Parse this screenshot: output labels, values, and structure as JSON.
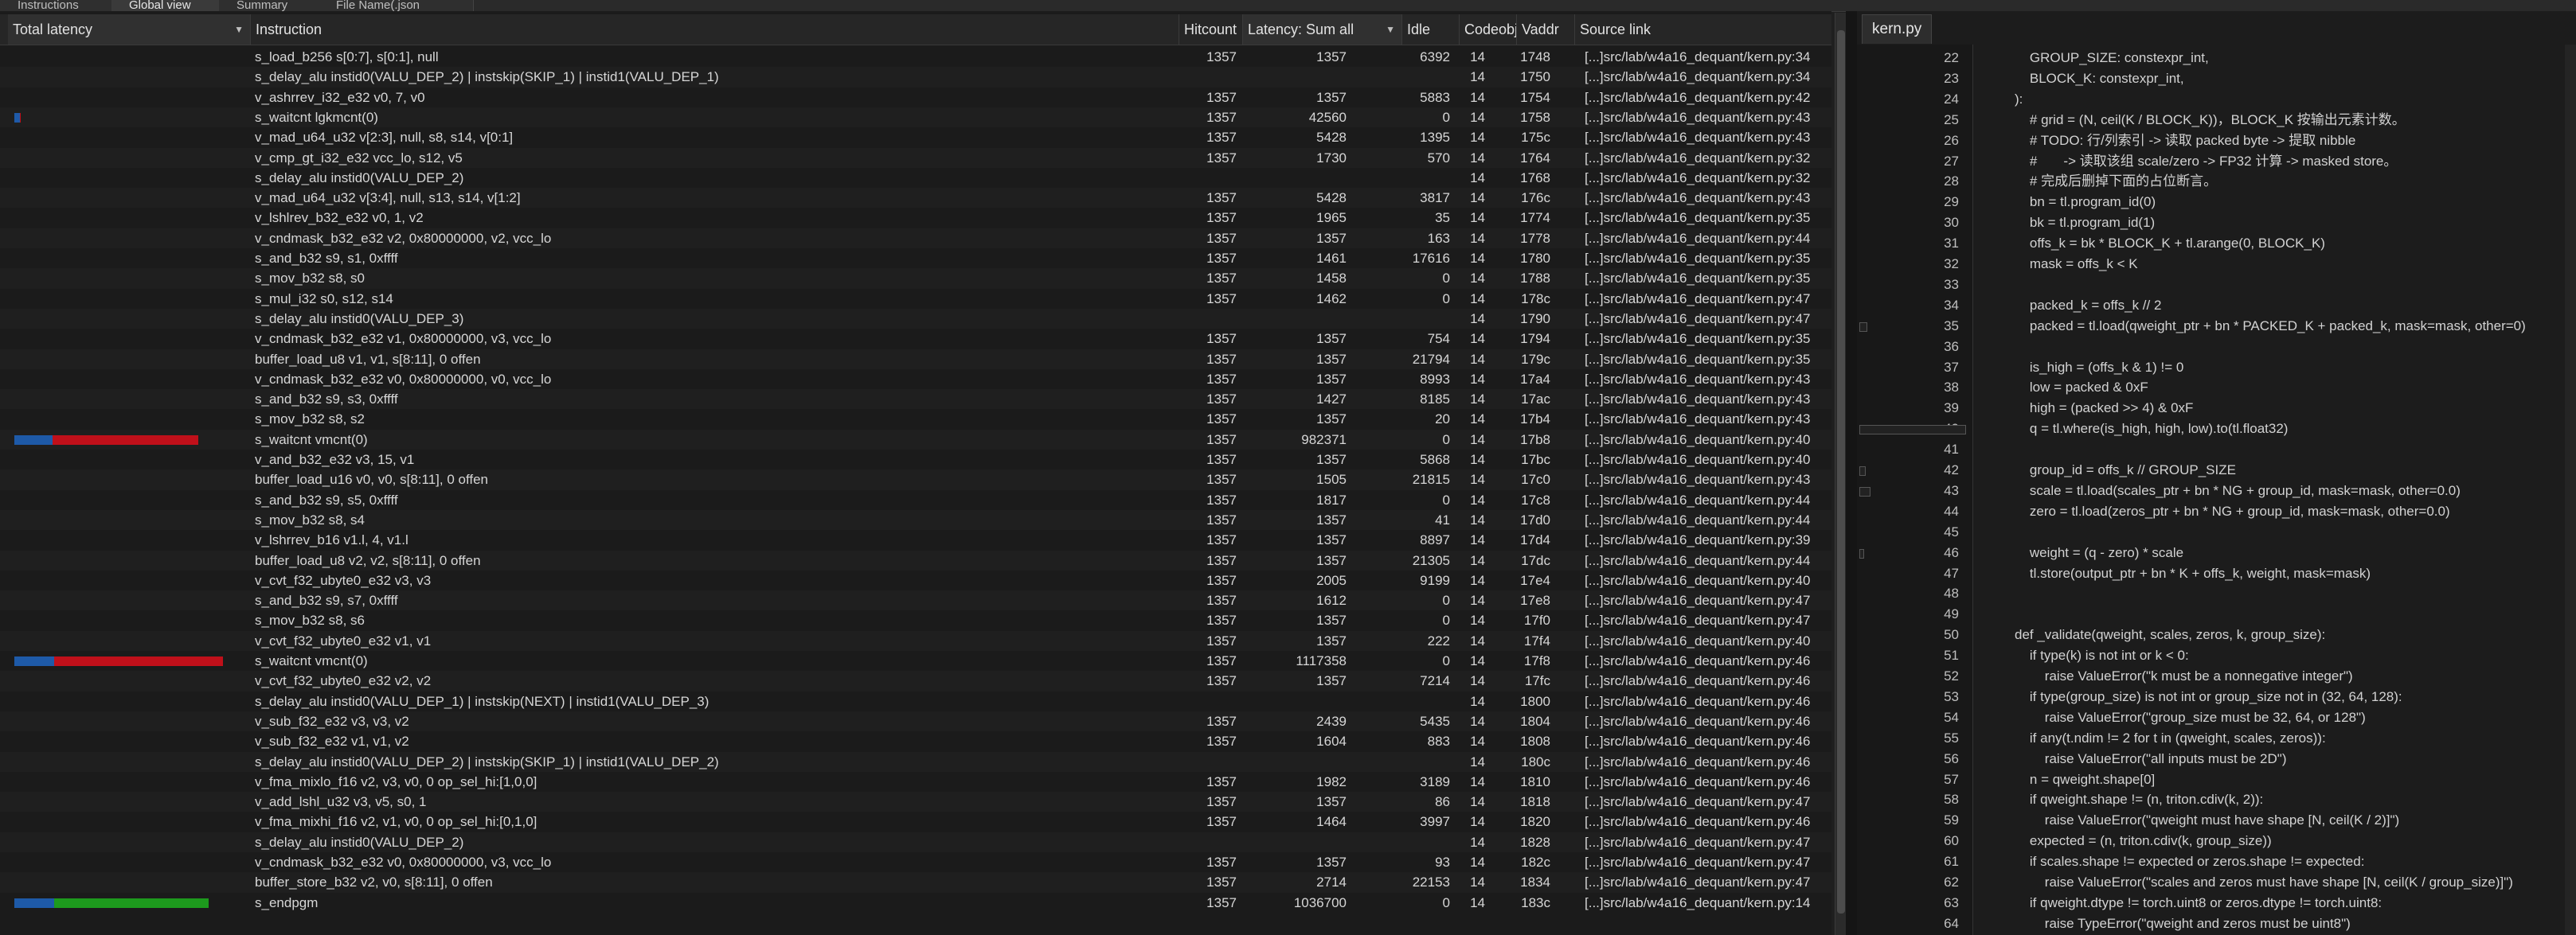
{
  "top_tabs": [
    "Instructions",
    "Global view",
    "Summary",
    "File Name(.json"
  ],
  "columns": {
    "total_latency": "Total latency",
    "instruction": "Instruction",
    "hitcount": "Hitcount",
    "latency": "Latency: Sum all",
    "idle": "Idle",
    "codeobj": "Codeobj",
    "vaddr": "Vaddr",
    "source": "Source link"
  },
  "rows": [
    {
      "instr": "s_load_b256 s[0:7], s[0:1], null",
      "hit": "1357",
      "lat": "1357",
      "idle": "6392",
      "co": "14",
      "va": "1748",
      "src": "[...]src/lab/w4a16_dequant/kern.py:34",
      "bar": 0
    },
    {
      "instr": "s_delay_alu instid0(VALU_DEP_2) | instskip(SKIP_1) | instid1(VALU_DEP_1)",
      "hit": "",
      "lat": "",
      "idle": "",
      "co": "14",
      "va": "1750",
      "src": "[...]src/lab/w4a16_dequant/kern.py:34",
      "bar": 0
    },
    {
      "instr": "v_ashrrev_i32_e32 v0, 7, v0",
      "hit": "1357",
      "lat": "1357",
      "idle": "5883",
      "co": "14",
      "va": "1754",
      "src": "[...]src/lab/w4a16_dequant/kern.py:42",
      "bar": 0
    },
    {
      "instr": "s_waitcnt lgkmcnt(0)",
      "hit": "1357",
      "lat": "42560",
      "idle": "0",
      "co": "14",
      "va": "1758",
      "src": "[...]src/lab/w4a16_dequant/kern.py:43",
      "bar": 0.03
    },
    {
      "instr": "v_mad_u64_u32 v[2:3], null, s8, s14, v[0:1]",
      "hit": "1357",
      "lat": "5428",
      "idle": "1395",
      "co": "14",
      "va": "175c",
      "src": "[...]src/lab/w4a16_dequant/kern.py:43",
      "bar": 0
    },
    {
      "instr": "v_cmp_gt_i32_e32 vcc_lo, s12, v5",
      "hit": "1357",
      "lat": "1730",
      "idle": "570",
      "co": "14",
      "va": "1764",
      "src": "[...]src/lab/w4a16_dequant/kern.py:32",
      "bar": 0
    },
    {
      "instr": "s_delay_alu instid0(VALU_DEP_2)",
      "hit": "",
      "lat": "",
      "idle": "",
      "co": "14",
      "va": "1768",
      "src": "[...]src/lab/w4a16_dequant/kern.py:32",
      "bar": 0
    },
    {
      "instr": "v_mad_u64_u32 v[3:4], null, s13, s14, v[1:2]",
      "hit": "1357",
      "lat": "5428",
      "idle": "3817",
      "co": "14",
      "va": "176c",
      "src": "[...]src/lab/w4a16_dequant/kern.py:43",
      "bar": 0
    },
    {
      "instr": "v_lshlrev_b32_e32 v0, 1, v2",
      "hit": "1357",
      "lat": "1965",
      "idle": "35",
      "co": "14",
      "va": "1774",
      "src": "[...]src/lab/w4a16_dequant/kern.py:35",
      "bar": 0
    },
    {
      "instr": "v_cndmask_b32_e32 v2, 0x80000000, v2, vcc_lo",
      "hit": "1357",
      "lat": "1357",
      "idle": "163",
      "co": "14",
      "va": "1778",
      "src": "[...]src/lab/w4a16_dequant/kern.py:44",
      "bar": 0
    },
    {
      "instr": "s_and_b32 s9, s1, 0xffff",
      "hit": "1357",
      "lat": "1461",
      "idle": "17616",
      "co": "14",
      "va": "1780",
      "src": "[...]src/lab/w4a16_dequant/kern.py:35",
      "bar": 0
    },
    {
      "instr": "s_mov_b32 s8, s0",
      "hit": "1357",
      "lat": "1458",
      "idle": "0",
      "co": "14",
      "va": "1788",
      "src": "[...]src/lab/w4a16_dequant/kern.py:35",
      "bar": 0
    },
    {
      "instr": "s_mul_i32 s0, s12, s14",
      "hit": "1357",
      "lat": "1462",
      "idle": "0",
      "co": "14",
      "va": "178c",
      "src": "[...]src/lab/w4a16_dequant/kern.py:47",
      "bar": 0
    },
    {
      "instr": "s_delay_alu instid0(VALU_DEP_3)",
      "hit": "",
      "lat": "",
      "idle": "",
      "co": "14",
      "va": "1790",
      "src": "[...]src/lab/w4a16_dequant/kern.py:47",
      "bar": 0
    },
    {
      "instr": "v_cndmask_b32_e32 v1, 0x80000000, v3, vcc_lo",
      "hit": "1357",
      "lat": "1357",
      "idle": "754",
      "co": "14",
      "va": "1794",
      "src": "[...]src/lab/w4a16_dequant/kern.py:35",
      "bar": 0
    },
    {
      "instr": "buffer_load_u8 v1, v1, s[8:11], 0 offen",
      "hit": "1357",
      "lat": "1357",
      "idle": "21794",
      "co": "14",
      "va": "179c",
      "src": "[...]src/lab/w4a16_dequant/kern.py:35",
      "bar": 0
    },
    {
      "instr": "v_cndmask_b32_e32 v0, 0x80000000, v0, vcc_lo",
      "hit": "1357",
      "lat": "1357",
      "idle": "8993",
      "co": "14",
      "va": "17a4",
      "src": "[...]src/lab/w4a16_dequant/kern.py:43",
      "bar": 0
    },
    {
      "instr": "s_and_b32 s9, s3, 0xffff",
      "hit": "1357",
      "lat": "1427",
      "idle": "8185",
      "co": "14",
      "va": "17ac",
      "src": "[...]src/lab/w4a16_dequant/kern.py:43",
      "bar": 0
    },
    {
      "instr": "s_mov_b32 s8, s2",
      "hit": "1357",
      "lat": "1357",
      "idle": "20",
      "co": "14",
      "va": "17b4",
      "src": "[...]src/lab/w4a16_dequant/kern.py:43",
      "bar": 0
    },
    {
      "instr": "s_waitcnt vmcnt(0)",
      "hit": "1357",
      "lat": "982371",
      "idle": "0",
      "co": "14",
      "va": "17b8",
      "src": "[...]src/lab/w4a16_dequant/kern.py:40",
      "bar": 0.88
    },
    {
      "instr": "v_and_b32_e32 v3, 15, v1",
      "hit": "1357",
      "lat": "1357",
      "idle": "5868",
      "co": "14",
      "va": "17bc",
      "src": "[...]src/lab/w4a16_dequant/kern.py:40",
      "bar": 0
    },
    {
      "instr": "buffer_load_u16 v0, v0, s[8:11], 0 offen",
      "hit": "1357",
      "lat": "1505",
      "idle": "21815",
      "co": "14",
      "va": "17c0",
      "src": "[...]src/lab/w4a16_dequant/kern.py:43",
      "bar": 0
    },
    {
      "instr": "s_and_b32 s9, s5, 0xffff",
      "hit": "1357",
      "lat": "1817",
      "idle": "0",
      "co": "14",
      "va": "17c8",
      "src": "[...]src/lab/w4a16_dequant/kern.py:44",
      "bar": 0
    },
    {
      "instr": "s_mov_b32 s8, s4",
      "hit": "1357",
      "lat": "1357",
      "idle": "41",
      "co": "14",
      "va": "17d0",
      "src": "[...]src/lab/w4a16_dequant/kern.py:44",
      "bar": 0
    },
    {
      "instr": "v_lshrrev_b16 v1.l, 4, v1.l",
      "hit": "1357",
      "lat": "1357",
      "idle": "8897",
      "co": "14",
      "va": "17d4",
      "src": "[...]src/lab/w4a16_dequant/kern.py:39",
      "bar": 0
    },
    {
      "instr": "buffer_load_u8 v2, v2, s[8:11], 0 offen",
      "hit": "1357",
      "lat": "1357",
      "idle": "21305",
      "co": "14",
      "va": "17dc",
      "src": "[...]src/lab/w4a16_dequant/kern.py:44",
      "bar": 0
    },
    {
      "instr": "v_cvt_f32_ubyte0_e32 v3, v3",
      "hit": "1357",
      "lat": "2005",
      "idle": "9199",
      "co": "14",
      "va": "17e4",
      "src": "[...]src/lab/w4a16_dequant/kern.py:40",
      "bar": 0
    },
    {
      "instr": "s_and_b32 s9, s7, 0xffff",
      "hit": "1357",
      "lat": "1612",
      "idle": "0",
      "co": "14",
      "va": "17e8",
      "src": "[...]src/lab/w4a16_dequant/kern.py:47",
      "bar": 0
    },
    {
      "instr": "s_mov_b32 s8, s6",
      "hit": "1357",
      "lat": "1357",
      "idle": "0",
      "co": "14",
      "va": "17f0",
      "src": "[...]src/lab/w4a16_dequant/kern.py:47",
      "bar": 0
    },
    {
      "instr": "v_cvt_f32_ubyte0_e32 v1, v1",
      "hit": "1357",
      "lat": "1357",
      "idle": "222",
      "co": "14",
      "va": "17f4",
      "src": "[...]src/lab/w4a16_dequant/kern.py:40",
      "bar": 0
    },
    {
      "instr": "s_waitcnt vmcnt(0)",
      "hit": "1357",
      "lat": "1117358",
      "idle": "0",
      "co": "14",
      "va": "17f8",
      "src": "[...]src/lab/w4a16_dequant/kern.py:46",
      "bar": 1.0
    },
    {
      "instr": "v_cvt_f32_ubyte0_e32 v2, v2",
      "hit": "1357",
      "lat": "1357",
      "idle": "7214",
      "co": "14",
      "va": "17fc",
      "src": "[...]src/lab/w4a16_dequant/kern.py:46",
      "bar": 0
    },
    {
      "instr": "s_delay_alu instid0(VALU_DEP_1) | instskip(NEXT) | instid1(VALU_DEP_3)",
      "hit": "",
      "lat": "",
      "idle": "",
      "co": "14",
      "va": "1800",
      "src": "[...]src/lab/w4a16_dequant/kern.py:46",
      "bar": 0
    },
    {
      "instr": "v_sub_f32_e32 v3, v3, v2",
      "hit": "1357",
      "lat": "2439",
      "idle": "5435",
      "co": "14",
      "va": "1804",
      "src": "[...]src/lab/w4a16_dequant/kern.py:46",
      "bar": 0
    },
    {
      "instr": "v_sub_f32_e32 v1, v1, v2",
      "hit": "1357",
      "lat": "1604",
      "idle": "883",
      "co": "14",
      "va": "1808",
      "src": "[...]src/lab/w4a16_dequant/kern.py:46",
      "bar": 0
    },
    {
      "instr": "s_delay_alu instid0(VALU_DEP_2) | instskip(SKIP_1) | instid1(VALU_DEP_2)",
      "hit": "",
      "lat": "",
      "idle": "",
      "co": "14",
      "va": "180c",
      "src": "[...]src/lab/w4a16_dequant/kern.py:46",
      "bar": 0
    },
    {
      "instr": "v_fma_mixlo_f16 v2, v3, v0, 0 op_sel_hi:[1,0,0]",
      "hit": "1357",
      "lat": "1982",
      "idle": "3189",
      "co": "14",
      "va": "1810",
      "src": "[...]src/lab/w4a16_dequant/kern.py:46",
      "bar": 0
    },
    {
      "instr": "v_add_lshl_u32 v3, v5, s0, 1",
      "hit": "1357",
      "lat": "1357",
      "idle": "86",
      "co": "14",
      "va": "1818",
      "src": "[...]src/lab/w4a16_dequant/kern.py:47",
      "bar": 0
    },
    {
      "instr": "v_fma_mixhi_f16 v2, v1, v0, 0 op_sel_hi:[0,1,0]",
      "hit": "1357",
      "lat": "1464",
      "idle": "3997",
      "co": "14",
      "va": "1820",
      "src": "[...]src/lab/w4a16_dequant/kern.py:46",
      "bar": 0
    },
    {
      "instr": "s_delay_alu instid0(VALU_DEP_2)",
      "hit": "",
      "lat": "",
      "idle": "",
      "co": "14",
      "va": "1828",
      "src": "[...]src/lab/w4a16_dequant/kern.py:47",
      "bar": 0
    },
    {
      "instr": "v_cndmask_b32_e32 v0, 0x80000000, v3, vcc_lo",
      "hit": "1357",
      "lat": "1357",
      "idle": "93",
      "co": "14",
      "va": "182c",
      "src": "[...]src/lab/w4a16_dequant/kern.py:47",
      "bar": 0
    },
    {
      "instr": "buffer_store_b32 v2, v0, s[8:11], 0 offen",
      "hit": "1357",
      "lat": "2714",
      "idle": "22153",
      "co": "14",
      "va": "1834",
      "src": "[...]src/lab/w4a16_dequant/kern.py:47",
      "bar": 0
    },
    {
      "instr": "s_endpgm",
      "hit": "1357",
      "lat": "1036700",
      "idle": "0",
      "co": "14",
      "va": "183c",
      "src": "[...]src/lab/w4a16_dequant/kern.py:14",
      "bar": 0.93,
      "green": true
    }
  ],
  "file_tab": "kern.py",
  "code_lines": [
    {
      "n": "22",
      "t": "    GROUP_SIZE: constexpr_int,"
    },
    {
      "n": "23",
      "t": "    BLOCK_K: constexpr_int,"
    },
    {
      "n": "24",
      "t": "):"
    },
    {
      "n": "25",
      "t": "    # grid = (N, ceil(K / BLOCK_K))，BLOCK_K 按输出元素计数。"
    },
    {
      "n": "26",
      "t": "    # TODO: 行/列索引 -> 读取 packed byte -> 提取 nibble"
    },
    {
      "n": "27",
      "t": "    #       -> 读取该组 scale/zero -> FP32 计算 -> masked store。"
    },
    {
      "n": "28",
      "t": "    # 完成后删掉下面的占位断言。"
    },
    {
      "n": "29",
      "t": "    bn = tl.program_id(0)"
    },
    {
      "n": "30",
      "t": "    bk = tl.program_id(1)"
    },
    {
      "n": "31",
      "t": "    offs_k = bk * BLOCK_K + tl.arange(0, BLOCK_K)"
    },
    {
      "n": "32",
      "t": "    mask = offs_k < K"
    },
    {
      "n": "33",
      "t": ""
    },
    {
      "n": "34",
      "t": "    packed_k = offs_k // 2"
    },
    {
      "n": "35",
      "t": "    packed = tl.load(qweight_ptr + bn * PACKED_K + packed_k, mask=mask, other=0)"
    },
    {
      "n": "36",
      "t": ""
    },
    {
      "n": "37",
      "t": "    is_high = (offs_k & 1) != 0"
    },
    {
      "n": "38",
      "t": "    low = packed & 0xF"
    },
    {
      "n": "39",
      "t": "    high = (packed >> 4) & 0xF"
    },
    {
      "n": "40",
      "t": "    q = tl.where(is_high, high, low).to(tl.float32)"
    },
    {
      "n": "41",
      "t": ""
    },
    {
      "n": "42",
      "t": "    group_id = offs_k // GROUP_SIZE"
    },
    {
      "n": "43",
      "t": "    scale = tl.load(scales_ptr + bn * NG + group_id, mask=mask, other=0.0)"
    },
    {
      "n": "44",
      "t": "    zero = tl.load(zeros_ptr + bn * NG + group_id, mask=mask, other=0.0)"
    },
    {
      "n": "45",
      "t": ""
    },
    {
      "n": "46",
      "t": "    weight = (q - zero) * scale"
    },
    {
      "n": "47",
      "t": "    tl.store(output_ptr + bn * K + offs_k, weight, mask=mask)"
    },
    {
      "n": "48",
      "t": ""
    },
    {
      "n": "49",
      "t": ""
    },
    {
      "n": "50",
      "t": "def _validate(qweight, scales, zeros, k, group_size):"
    },
    {
      "n": "51",
      "t": "    if type(k) is not int or k < 0:"
    },
    {
      "n": "52",
      "t": "        raise ValueError(\"k must be a nonnegative integer\")"
    },
    {
      "n": "53",
      "t": "    if type(group_size) is not int or group_size not in (32, 64, 128):"
    },
    {
      "n": "54",
      "t": "        raise ValueError(\"group_size must be 32, 64, or 128\")"
    },
    {
      "n": "55",
      "t": "    if any(t.ndim != 2 for t in (qweight, scales, zeros)):"
    },
    {
      "n": "56",
      "t": "        raise ValueError(\"all inputs must be 2D\")"
    },
    {
      "n": "57",
      "t": "    n = qweight.shape[0]"
    },
    {
      "n": "58",
      "t": "    if qweight.shape != (n, triton.cdiv(k, 2)):"
    },
    {
      "n": "59",
      "t": "        raise ValueError(\"qweight must have shape [N, ceil(K / 2)]\")"
    },
    {
      "n": "60",
      "t": "    expected = (n, triton.cdiv(k, group_size))"
    },
    {
      "n": "61",
      "t": "    if scales.shape != expected or zeros.shape != expected:"
    },
    {
      "n": "62",
      "t": "        raise ValueError(\"scales and zeros must have shape [N, ceil(K / group_size)]\")"
    },
    {
      "n": "63",
      "t": "    if qweight.dtype != torch.uint8 or zeros.dtype != torch.uint8:"
    },
    {
      "n": "64",
      "t": "        raise TypeError(\"qweight and zeros must be uint8\")"
    }
  ],
  "colors": {
    "bar_blue": "#1e5aa8",
    "bar_red": "#c0101a",
    "bar_green": "#1d9a1d"
  }
}
